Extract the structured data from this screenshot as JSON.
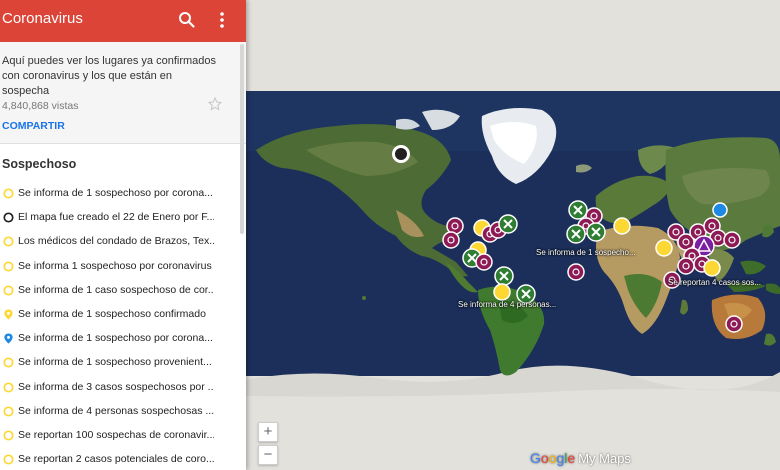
{
  "app": {
    "title": "Coronavirus"
  },
  "info": {
    "description": "Aquí puedes ver los lugares ya confirmados con coronavirus y los que están en sospecha",
    "views": "4,840,868 vistas",
    "share_label": "COMPARTIR"
  },
  "layer": {
    "title": "Sospechoso",
    "items": [
      {
        "text": "Se informa de 1 sospechoso por corona...",
        "icon": "yellow-circle-icon",
        "color": "#fdd835"
      },
      {
        "text": "El mapa fue creado el 22 de Enero por F...",
        "icon": "black-circle-icon",
        "color": "#212121"
      },
      {
        "text": "Los médicos del condado de Brazos, Tex...",
        "icon": "yellow-circle-icon",
        "color": "#fdd835"
      },
      {
        "text": "Se informa 1 sospechoso por coronavirus",
        "icon": "yellow-circle-icon",
        "color": "#fdd835"
      },
      {
        "text": "Se informa de 1 caso sospechoso de cor...",
        "icon": "yellow-circle-icon",
        "color": "#fdd835"
      },
      {
        "text": "Se informa de 1 sospechoso confirmado",
        "icon": "yellow-pin-icon",
        "color": "#fdd835"
      },
      {
        "text": "Se informa de 1 sospechoso por corona...",
        "icon": "blue-pin-icon",
        "color": "#1e88e5"
      },
      {
        "text": "Se informa de 1 sospechoso provenient...",
        "icon": "yellow-circle-icon",
        "color": "#fdd835"
      },
      {
        "text": "Se informa de 3 casos sospechosos por ...",
        "icon": "yellow-circle-icon",
        "color": "#fdd835"
      },
      {
        "text": "Se informa de 4 personas sospechosas ...",
        "icon": "yellow-circle-icon",
        "color": "#fdd835"
      },
      {
        "text": "Se reportan 100 sospechas de coronavir...",
        "icon": "yellow-circle-icon",
        "color": "#fdd835"
      },
      {
        "text": "Se reportan 2 casos potenciales de coro...",
        "icon": "yellow-circle-icon",
        "color": "#fdd835"
      }
    ]
  },
  "map": {
    "labels": [
      "Se informa de 1 sospecho...",
      "Se informa de 4 personas...",
      "Se reportan 4 casos sos..."
    ],
    "zoom_in": "+",
    "zoom_out": "−",
    "brand": {
      "g1": "G",
      "g2": "o",
      "g3": "o",
      "g4": "g",
      "g5": "l",
      "g6": "e",
      "product": "My Maps"
    },
    "colors": {
      "biohazard": "#8e1a55",
      "green_x": "#2e7d32",
      "yellow": "#fdd835",
      "blue": "#1e88e5",
      "purple": "#7b1fa2",
      "ocean": "#1b2f5a"
    }
  },
  "accent": "#db4437"
}
